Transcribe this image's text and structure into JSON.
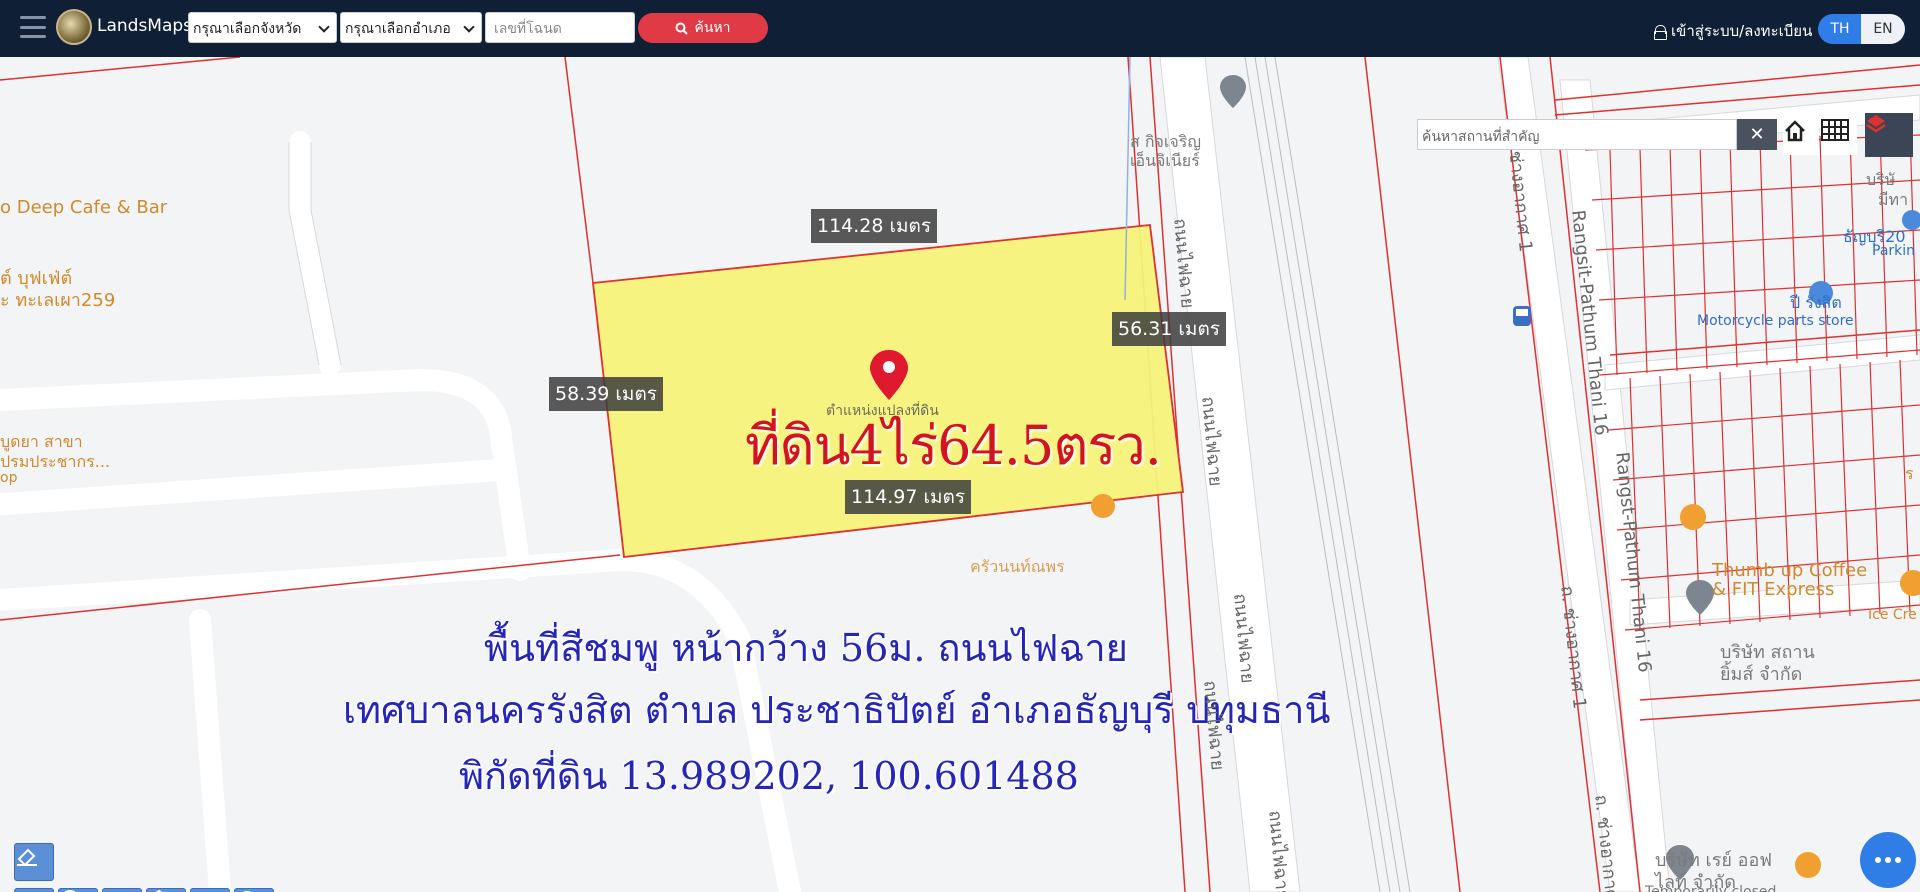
{
  "header": {
    "brand": "LandsMaps",
    "province_select": "กรุณาเลือกจังหวัด",
    "district_select": "กรุณาเลือกอำเภอ",
    "deed_placeholder": "เลขที่โฉนด",
    "search_label": "ค้นหา",
    "login_label": "เข้าสู่ระบบ/ลงทะเบียน",
    "lang_th": "TH",
    "lang_en": "EN"
  },
  "map_tools": {
    "place_search_placeholder": "ค้นหาสถานที่สำคัญ",
    "clear_label": "✕"
  },
  "parcel": {
    "title": "ที่ดิน4ไร่64.5ตรว.",
    "pin_caption": "ตำแหน่งแปลงที่ดิน",
    "dim_top": "114.28 เมตร",
    "dim_right": "56.31 เมตร",
    "dim_left": "58.39 เมตร",
    "dim_bottom": "114.97 เมตร",
    "fill_color": "#f5f27a",
    "boundary_color": "#e03030"
  },
  "description": {
    "line1": "พื้นที่สีชมพู หน้ากว้าง 56ม. ถนนไฟฉาย",
    "line2": "เทศบาลนครรังสิต ตำบล ประชาธิปัตย์ อำเภอธัญบุรี ปทุมธานี",
    "line3": "พิกัดที่ดิน 13.989202, 100.601488"
  },
  "pois": {
    "cafe_bar": "o Deep Cafe & Bar",
    "buffet_1": "ต์ บุฟเฟ่ต์",
    "buffet_2": "ะ ทะเลเผา259",
    "left_3": "บูดยา สาขา",
    "left_4": "ปรมประชากร...",
    "left_5": "op",
    "kitcharoen_1": "ส กิจเจริญ",
    "kitcharoen_2": "เอ็นจิเนียร์",
    "restaurant": "ครัวนนท์ณพร",
    "company_top_1": "บริษั",
    "company_top_2": "มีทา",
    "thanyaburi": "ธัญบุรี20",
    "parking": "Parkin",
    "motorcycle_th": "ปี รังสิต",
    "motorcycle_en": "Motorcycle parts store",
    "thumbup_1": "Thumb up Coffee",
    "thumbup_2": "& FIT Express",
    "ice": "Ice Cre",
    "company_mid_1": "บริษัท สถาน",
    "company_mid_2": "ยิ้มส์ จำกัด",
    "company_bot_1": "บริษัท เรย์ ออฟ",
    "company_bot_2": "ไลท์ จำกัด",
    "temporarily_closed": "Temporarily closed",
    "right_edge": "ร"
  },
  "roads": {
    "faichai_1": "ถนนไฟฉาย",
    "faichai_2": "ถนนไฟฉาย",
    "faichai_3": "ถนนไฟฉาย",
    "faichai_4": "ถนนไฟฉาย",
    "faichai_5": "ถนนไฟฉาย",
    "rangsit_1": "Rangsit-Pathum Thani 16",
    "rangsit_2": "Rangst-Pathum Thani 16",
    "changakat_1": "ถ. ช่างอากาศ 1",
    "changakat_2": "ถ. ช่างอากาศ 1",
    "changakat_3": "ถ. ช่างอากาศ 1"
  },
  "icons": [
    "menu-icon",
    "search-icon",
    "lock-icon",
    "home-icon",
    "grid-icon",
    "layers-icon",
    "map-pin-icon",
    "bus-icon",
    "eraser-icon",
    "ruler-icon",
    "marker-icon",
    "polyline-icon",
    "polygon-icon",
    "rectangle-icon",
    "circle-icon",
    "chat-icon"
  ]
}
